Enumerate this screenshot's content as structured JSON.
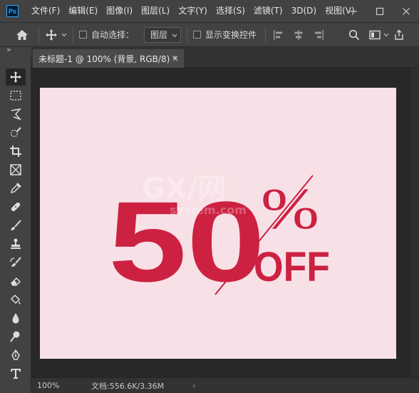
{
  "app": {
    "logo": "Ps",
    "menus": [
      "文件(F)",
      "编辑(E)",
      "图像(I)",
      "图层(L)",
      "文字(Y)",
      "选择(S)",
      "滤镜(T)",
      "3D(D)",
      "视图(V)"
    ]
  },
  "window_controls": {
    "minimize": "minimize-icon",
    "maximize": "maximize-icon",
    "close": "close-icon"
  },
  "options_bar": {
    "auto_select_label": "自动选择：",
    "auto_select_checked": false,
    "layer_dropdown_value": "图层",
    "show_transform_label": "显示变换控件",
    "show_transform_checked": false
  },
  "toolbar": {
    "expand_glyph": "»",
    "tools": [
      "move-tool",
      "marquee-tool",
      "lasso-tool",
      "quick-select-tool",
      "crop-tool",
      "frame-tool",
      "eyedropper-tool",
      "healing-tool",
      "brush-tool",
      "stamp-tool",
      "history-brush-tool",
      "eraser-tool",
      "paint-bucket-tool",
      "blur-tool",
      "dodge-tool",
      "pen-tool",
      "type-tool"
    ]
  },
  "document": {
    "tab_title": "未标题-1 @ 100% (背景, RGB/8) *",
    "tab_close": "×"
  },
  "canvas_art": {
    "number": "50",
    "percent": "%",
    "off": "OFF",
    "watermark_top": "GX/网",
    "watermark_bottom": "system.com",
    "background_color": "#f8e1e6",
    "text_color": "#cd2142"
  },
  "status": {
    "zoom": "100%",
    "doc_info": "文档:556.6K/3.36M",
    "arrow": "›"
  }
}
